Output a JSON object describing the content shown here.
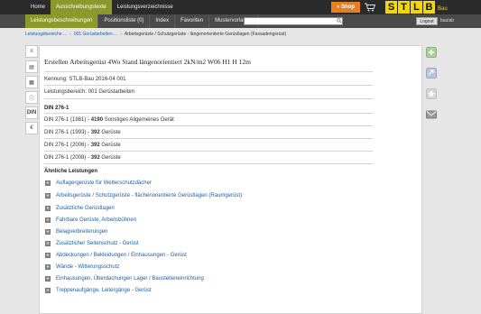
{
  "topnav": [
    {
      "label": "Home",
      "active": false
    },
    {
      "label": "Ausschreibungstexte",
      "active": true
    },
    {
      "label": "Leistungsverzeichnisse",
      "active": false
    }
  ],
  "shop": {
    "label": "» Shop"
  },
  "logo": {
    "letters": [
      "S",
      "T",
      "L",
      "B"
    ],
    "suffix": "Bau"
  },
  "subnav": [
    {
      "label": "Leistungsbeschreibungen",
      "active": true
    },
    {
      "label": "Positionsliste (0)",
      "active": false
    },
    {
      "label": "Index",
      "active": false
    },
    {
      "label": "Favoriten",
      "active": false
    },
    {
      "label": "Mustervorlagen",
      "active": false
    }
  ],
  "search": {
    "value": "",
    "placeholder": ""
  },
  "logout": {
    "label": "Logout"
  },
  "user": {
    "name": "baulab"
  },
  "breadcrumb": {
    "items": [
      "Leistungsbereiche ...",
      "001 Gerüstarbeiten ..."
    ],
    "current": "Arbeitsgerüste / Schutzgerüste - längenorientierte Gerüstlagen (Fassadengerüst)"
  },
  "tools": [
    "≡",
    "▤",
    "▦",
    "ⓘ",
    "DIN",
    "€"
  ],
  "main": {
    "title": "Erstellen Arbeitsgerüst 4Wo Stand längenorientiert 2kN/m2 W06 H1 H 12m",
    "kennung": "Kennung: STLB-Bau 2016-04 001",
    "bereich": "Leistungsbereich: 001 Gerüstarbeiten",
    "din_heading": "DIN 276-1",
    "din_rows": [
      {
        "prefix": "DIN 276-1 (1981) - ",
        "code": "4190",
        "text": " Sonstiges Allgemeines Gerät"
      },
      {
        "prefix": "DIN 276-1 (1993) - ",
        "code": "392",
        "text": " Gerüste"
      },
      {
        "prefix": "DIN 276-1 (2006) - ",
        "code": "392",
        "text": " Gerüste"
      },
      {
        "prefix": "DIN 276-1 (2008) - ",
        "code": "392",
        "text": " Gerüste"
      }
    ],
    "similar_heading": "Ähnliche Leistungen",
    "similar": [
      "Auflagergerüste für Wetterschutzdächer",
      "Arbeitsgerüste / Schutzgerüste - flächenorientierte Gerüstlagen (Raumgerüst)",
      "Zusätzliche Gerüstlagen",
      "Fahrbare Gerüste, Arbeitsbühnen",
      "Belagverbreiterungen",
      "Zusätzlicher Seitenschutz - Gerüst",
      "Abdeckungen / Bekleidungen / Einhausungen - Gerüst",
      "Wände - Witterungsschutz",
      "Einhausungen, Überdachungen Lager / Baustelleneinrichtung",
      "Treppenaufgänge, Leitergänge - Gerüst"
    ]
  },
  "colors": {
    "accent": "#8a9a2a",
    "shop": "#e87e1e",
    "logo": "#f2d700",
    "link": "#1e5fa0"
  }
}
